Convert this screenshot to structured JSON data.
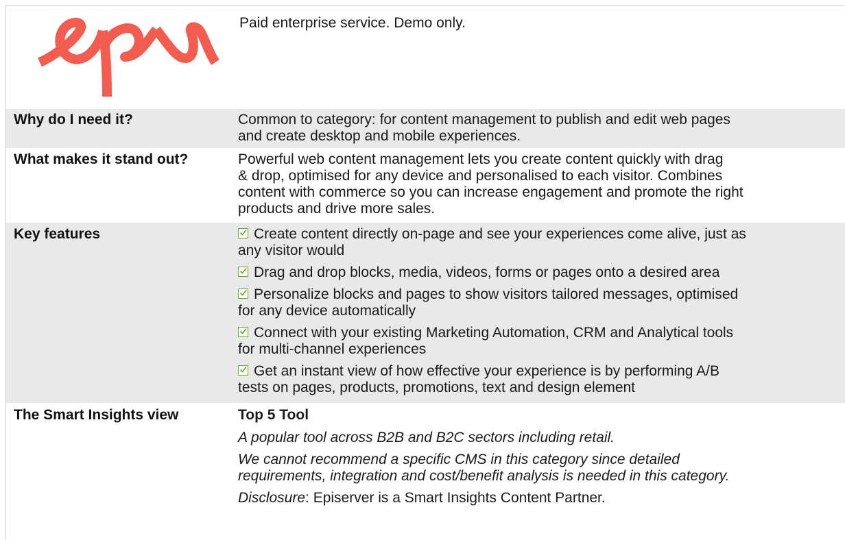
{
  "product": {
    "logo_text": "epi",
    "logo_color": "#f25d4f",
    "tagline": "Paid enterprise service. Demo only."
  },
  "rows": {
    "why": {
      "label": "Why do I need it?",
      "lines": [
        "Common to category: for content management to publish and edit web pages",
        "and create desktop and mobile experiences."
      ]
    },
    "stand_out": {
      "label": "What makes it stand out?",
      "lines": [
        "Powerful web content management lets you create content quickly with drag",
        "& drop, optimised for any device and personalised to each visitor. Combines",
        "content with commerce so you can increase engagement and promote the right",
        "products and drive more sales."
      ]
    },
    "features": {
      "label": "Key features",
      "check_color": "#6aa829",
      "items": [
        [
          "Create content directly on-page and see your experiences come alive, just as",
          "any visitor would"
        ],
        [
          "Drag and drop blocks, media, videos, forms or pages onto a desired area"
        ],
        [
          "Personalize blocks and pages to show visitors tailored messages, optimised",
          "for any device automatically"
        ],
        [
          "Connect with your existing Marketing Automation, CRM and Analytical tools",
          "for multi-channel experiences"
        ],
        [
          "Get an instant view of how effective your experience is by performing A/B",
          "tests on pages, products, promotions, text and design element"
        ]
      ]
    },
    "view": {
      "label": "The Smart Insights view",
      "title": "Top 5 Tool",
      "line1": "A popular tool across B2B and B2C sectors including retail.",
      "line2": [
        "We cannot recommend a specific CMS in this category since detailed",
        "requirements, integration and cost/benefit analysis is needed in this category."
      ],
      "disclosure_label": "Disclosure",
      "disclosure_text": ": Episerver is a Smart Insights Content Partner."
    }
  }
}
